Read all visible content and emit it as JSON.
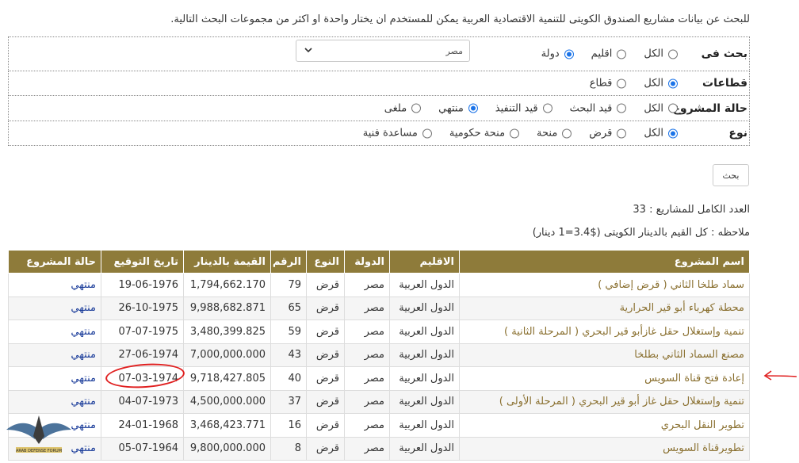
{
  "intro": "للبحث عن بيانات مشاريع الصندوق الكويتى للتنمية الاقتصادية العربية يمكن للمستخدم ان يختار واحدة او اكثر من مجموعات البحث التالية.",
  "filters": {
    "search_in": {
      "label": "بحث فى",
      "options": [
        "الكل",
        "اقليم",
        "دولة"
      ],
      "selected": "دولة",
      "country_value": "مصر"
    },
    "sectors": {
      "label": "قطاعات",
      "options": [
        "الكل",
        "قطاع"
      ],
      "selected": "الكل"
    },
    "status": {
      "label": "حالة المشروع",
      "options": [
        "الكل",
        "قيد البحث",
        "قيد التنفيذ",
        "منتهي",
        "ملغى"
      ],
      "selected": "منتهي"
    },
    "type": {
      "label": "نوع",
      "options": [
        "الكل",
        "قرض",
        "منحة",
        "منحة حكومية",
        "مساعدة فنية"
      ],
      "selected": "الكل"
    }
  },
  "search_button": "بحث",
  "total_label": "العدد الكامل للمشاريع : 33",
  "note": "ملاحظه : كل القيم بالدينار الكويتى ($3.4=1 دينار)",
  "table": {
    "headers": [
      "اسم المشروع",
      "الاقليم",
      "الدولة",
      "النوع",
      "الرقم",
      "القيمة بالدينار",
      "تاريخ التوقيع",
      "حالة المشروع"
    ],
    "rows": [
      [
        "سماد طلخا الثاني ( قرض إضافي )",
        "الدول العربية",
        "مصر",
        "قرض",
        "79",
        "1,794,662.170",
        "19-06-1976",
        "منتهي"
      ],
      [
        "محطة كهرباء أبو قير الحرارية",
        "الدول العربية",
        "مصر",
        "قرض",
        "65",
        "9,988,682.871",
        "26-10-1975",
        "منتهي"
      ],
      [
        "تنمية وإستغلال حقل غازأبو قير البحري ( المرحلة الثانية )",
        "الدول العربية",
        "مصر",
        "قرض",
        "59",
        "3,480,399.825",
        "07-07-1975",
        "منتهي"
      ],
      [
        "مصنع السماد الثاني بطلخا",
        "الدول العربية",
        "مصر",
        "قرض",
        "43",
        "7,000,000.000",
        "27-06-1974",
        "منتهي"
      ],
      [
        "إعادة فتح قناة السويس",
        "الدول العربية",
        "مصر",
        "قرض",
        "40",
        "9,718,427.805",
        "07-03-1974",
        "منتهي"
      ],
      [
        "تنمية وإستغلال حقل غاز أبو قير البحري ( المرحلة الأولى )",
        "الدول العربية",
        "مصر",
        "قرض",
        "37",
        "4,500,000.000",
        "04-07-1973",
        "منتهي"
      ],
      [
        "تطوير النقل البحري",
        "الدول العربية",
        "مصر",
        "قرض",
        "16",
        "3,468,423.771",
        "24-01-1968",
        "منتهي"
      ],
      [
        "تطويرقناة السويس",
        "الدول العربية",
        "مصر",
        "قرض",
        "8",
        "9,800,000.000",
        "05-07-1964",
        "منتهي"
      ]
    ]
  },
  "colors": {
    "header_bg": "#8e7b3a",
    "project_link": "#8a7030",
    "status_link": "#1a3c9a",
    "annotation": "#e02020"
  },
  "annotations": {
    "circle_target_row": 4,
    "arrow_target_row": 4
  },
  "watermark": "ARAB DEFENSE FORUM"
}
